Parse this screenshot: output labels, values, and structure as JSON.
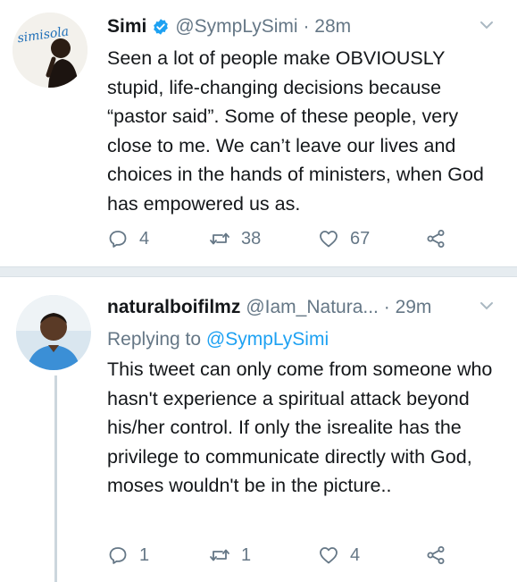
{
  "tweets": [
    {
      "display_name": "Simi",
      "handle": "@SympLySimi",
      "separator": "·",
      "time": "28m",
      "text": "Seen a lot of people make OBVIOUSLY stupid, life-changing decisions because “pastor said”. Some of these people, very close to me. We can’t leave our lives and choices in the hands of ministers, when God has empowered us as.",
      "avatar_text": "simisola",
      "verified": true,
      "actions": {
        "replies": "4",
        "retweets": "38",
        "likes": "67"
      }
    },
    {
      "display_name": "naturalboifilmz",
      "handle": "@Iam_Natura...",
      "separator": "·",
      "time": "29m",
      "replying_to_label": "Replying to",
      "replying_to_handle": "@SympLySimi",
      "text": "This tweet can only come from someone who hasn't experience a spiritual attack beyond his/her control. If only the isrealite has the privilege to communicate directly with God, moses wouldn't be in the picture..",
      "verified": false,
      "actions": {
        "replies": "1",
        "retweets": "1",
        "likes": "4"
      }
    }
  ],
  "icons": {
    "reply": "reply-icon",
    "retweet": "retweet-icon",
    "like": "heart-icon",
    "share": "share-icon",
    "verified": "verified-badge-icon",
    "menu": "chevron-down-icon"
  },
  "colors": {
    "text": "#14171a",
    "secondary": "#657786",
    "link": "#1da1f2",
    "separator": "#e6ecf0"
  }
}
